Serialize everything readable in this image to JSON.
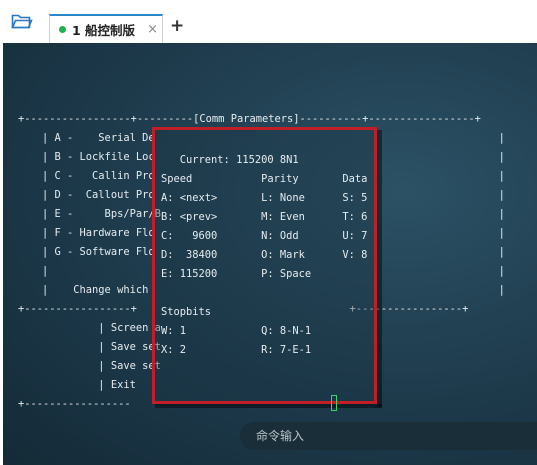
{
  "tabbar": {
    "tab_label": "1 船控制版",
    "close_glyph": "×",
    "add_glyph": "+"
  },
  "terminal": {
    "background_lines": [
      "+-----------------+---------[Comm Parameters]----------+-----------------+",
      "| A -    Serial De                                                       |",
      "| B - Lockfile Loc                                                       |",
      "| C -   Callin Pro                                                       |",
      "| D -  Callout Pro                                                       |",
      "| E -     Bps/Par/B                                                      |",
      "| F - Hardware Flo                                                       |",
      "| G - Software Flo                                                       |",
      "|                                                                        |",
      "|    Change which                                                        |",
      "+-----------------+                                  +-----------------+",
      "         | Screen a",
      "         | Save set",
      "         | Save set",
      "         | Exit",
      "+-----------------"
    ],
    "dialog": {
      "current": "   Current: 115200 8N1",
      "header": "Speed           Parity       Data",
      "rows": [
        "A: <next>       L: None      S: 5",
        "B: <prev>       M: Even      T: 6",
        "C:   9600       N: Odd       U: 7",
        "D:  38400       O: Mark      V: 8",
        "E: 115200       P: Space"
      ],
      "stopbits_label": "Stopbits",
      "stopbits_rows": [
        "W: 1            Q: 8-N-1",
        "X: 2            R: 7-E-1"
      ]
    }
  },
  "command": {
    "placeholder": "命令输入"
  },
  "colors": {
    "accent": "#2a88c8",
    "status_dot": "#22b14c",
    "dialog_border": "#c01f27",
    "cursor": "#3fd46a"
  }
}
